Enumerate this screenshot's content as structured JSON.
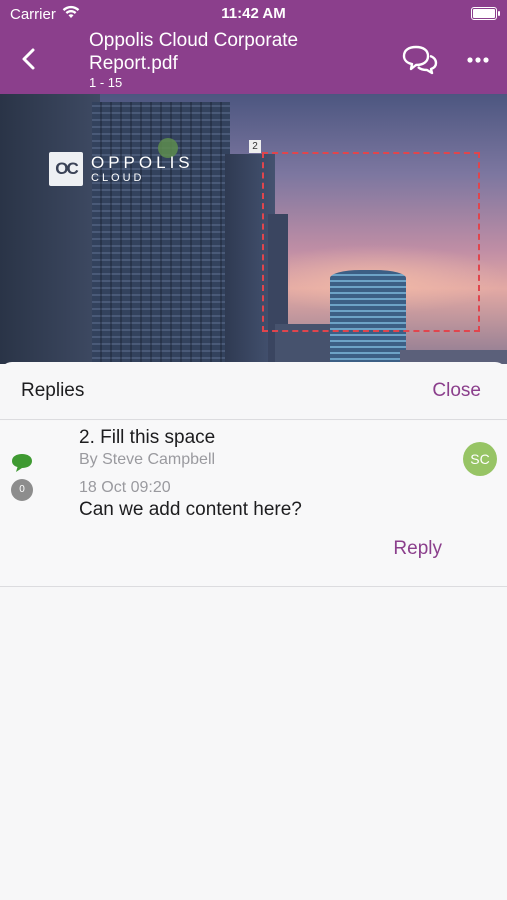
{
  "status_bar": {
    "carrier": "Carrier",
    "time": "11:42 AM"
  },
  "nav": {
    "title": "Oppolis Cloud Corporate Report.pdf",
    "page_range": "1 - 15",
    "icons": {
      "back": "chevron-left-icon",
      "comments": "comments-icon",
      "more": "more-icon"
    }
  },
  "document": {
    "logo_mark": "OC",
    "logo_main": "OPPOLIS",
    "logo_sub": "CLOUD",
    "annotation_number": "2"
  },
  "replies_sheet": {
    "title": "Replies",
    "close_label": "Close",
    "reply": {
      "title": "2. Fill this space",
      "author": "By Steve Campbell",
      "date": "18 Oct 09:20",
      "body": "Can we add content here?",
      "reply_count": "0",
      "avatar_initials": "SC",
      "reply_label": "Reply"
    }
  },
  "colors": {
    "brand": "#8b3f8c",
    "annotation": "#e0454d",
    "avatar": "#97c465",
    "comment_icon": "#3f9a32"
  }
}
